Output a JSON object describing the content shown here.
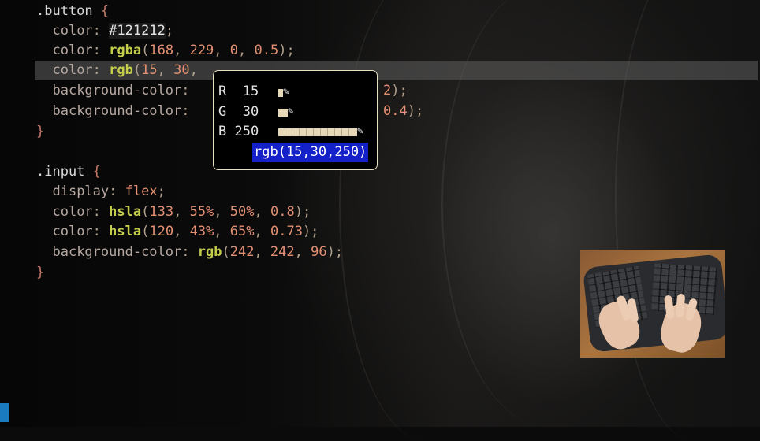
{
  "editor": {
    "rule1": {
      "selector": ".button",
      "open": "{",
      "close": "}",
      "line1": {
        "prop": "color",
        "colon": ":",
        "value": "#121212",
        "end": ";"
      },
      "line2": {
        "prop": "color",
        "colon": ":",
        "fn": "rgba",
        "open": "(",
        "a": "168",
        "s1": ", ",
        "b": "229",
        "s2": ", ",
        "c": "0",
        "s3": ", ",
        "d": "0.5",
        "close": ");"
      },
      "line3": {
        "prop": "color",
        "colon": ":",
        "fn": "rgb",
        "open": "(",
        "a": "15",
        "s1": ", ",
        "b": "30",
        "s2": ",",
        "tail": ""
      },
      "line4": {
        "prop": "background-color",
        "colon": ":",
        "tail_num": "2",
        "tail_end": ");"
      },
      "line5": {
        "prop": "background-color",
        "colon": ":",
        "tail_num": "0.4",
        "tail_end": ");"
      }
    },
    "rule2": {
      "selector": ".input",
      "open": "{",
      "close": "}",
      "line1": {
        "prop": "display",
        "colon": ":",
        "value": "flex",
        "end": ";"
      },
      "line2": {
        "prop": "color",
        "colon": ":",
        "fn": "hsla",
        "open": "(",
        "a": "133",
        "s1": ", ",
        "b": "55%",
        "s2": ", ",
        "c": "50%",
        "s3": ", ",
        "d": "0.8",
        "close": ");"
      },
      "line3": {
        "prop": "color",
        "colon": ":",
        "fn": "hsla",
        "open": "(",
        "a": "120",
        "s1": ", ",
        "b": "43%",
        "s2": ", ",
        "c": "65%",
        "s3": ", ",
        "d": "0.73",
        "close": ");"
      },
      "line4": {
        "prop": "background-color",
        "colon": ":",
        "fn": "rgb",
        "open": "(",
        "a": "242",
        "s1": ", ",
        "b": "242",
        "s2": ", ",
        "c": "96",
        "close": ");"
      }
    }
  },
  "picker": {
    "r_label": "R",
    "r_value": "15",
    "g_label": "G",
    "g_value": "30",
    "b_label": "B",
    "b_value": "250",
    "r_fraction": 0.06,
    "g_fraction": 0.12,
    "b_fraction": 0.98,
    "result": "rgb(15,30,250)"
  },
  "colors": {
    "selection_background": "#1420c8",
    "picker_border": "#e8dec0",
    "status_block": "#1a7bbf"
  },
  "icons": {
    "edit": "pencil-icon"
  }
}
